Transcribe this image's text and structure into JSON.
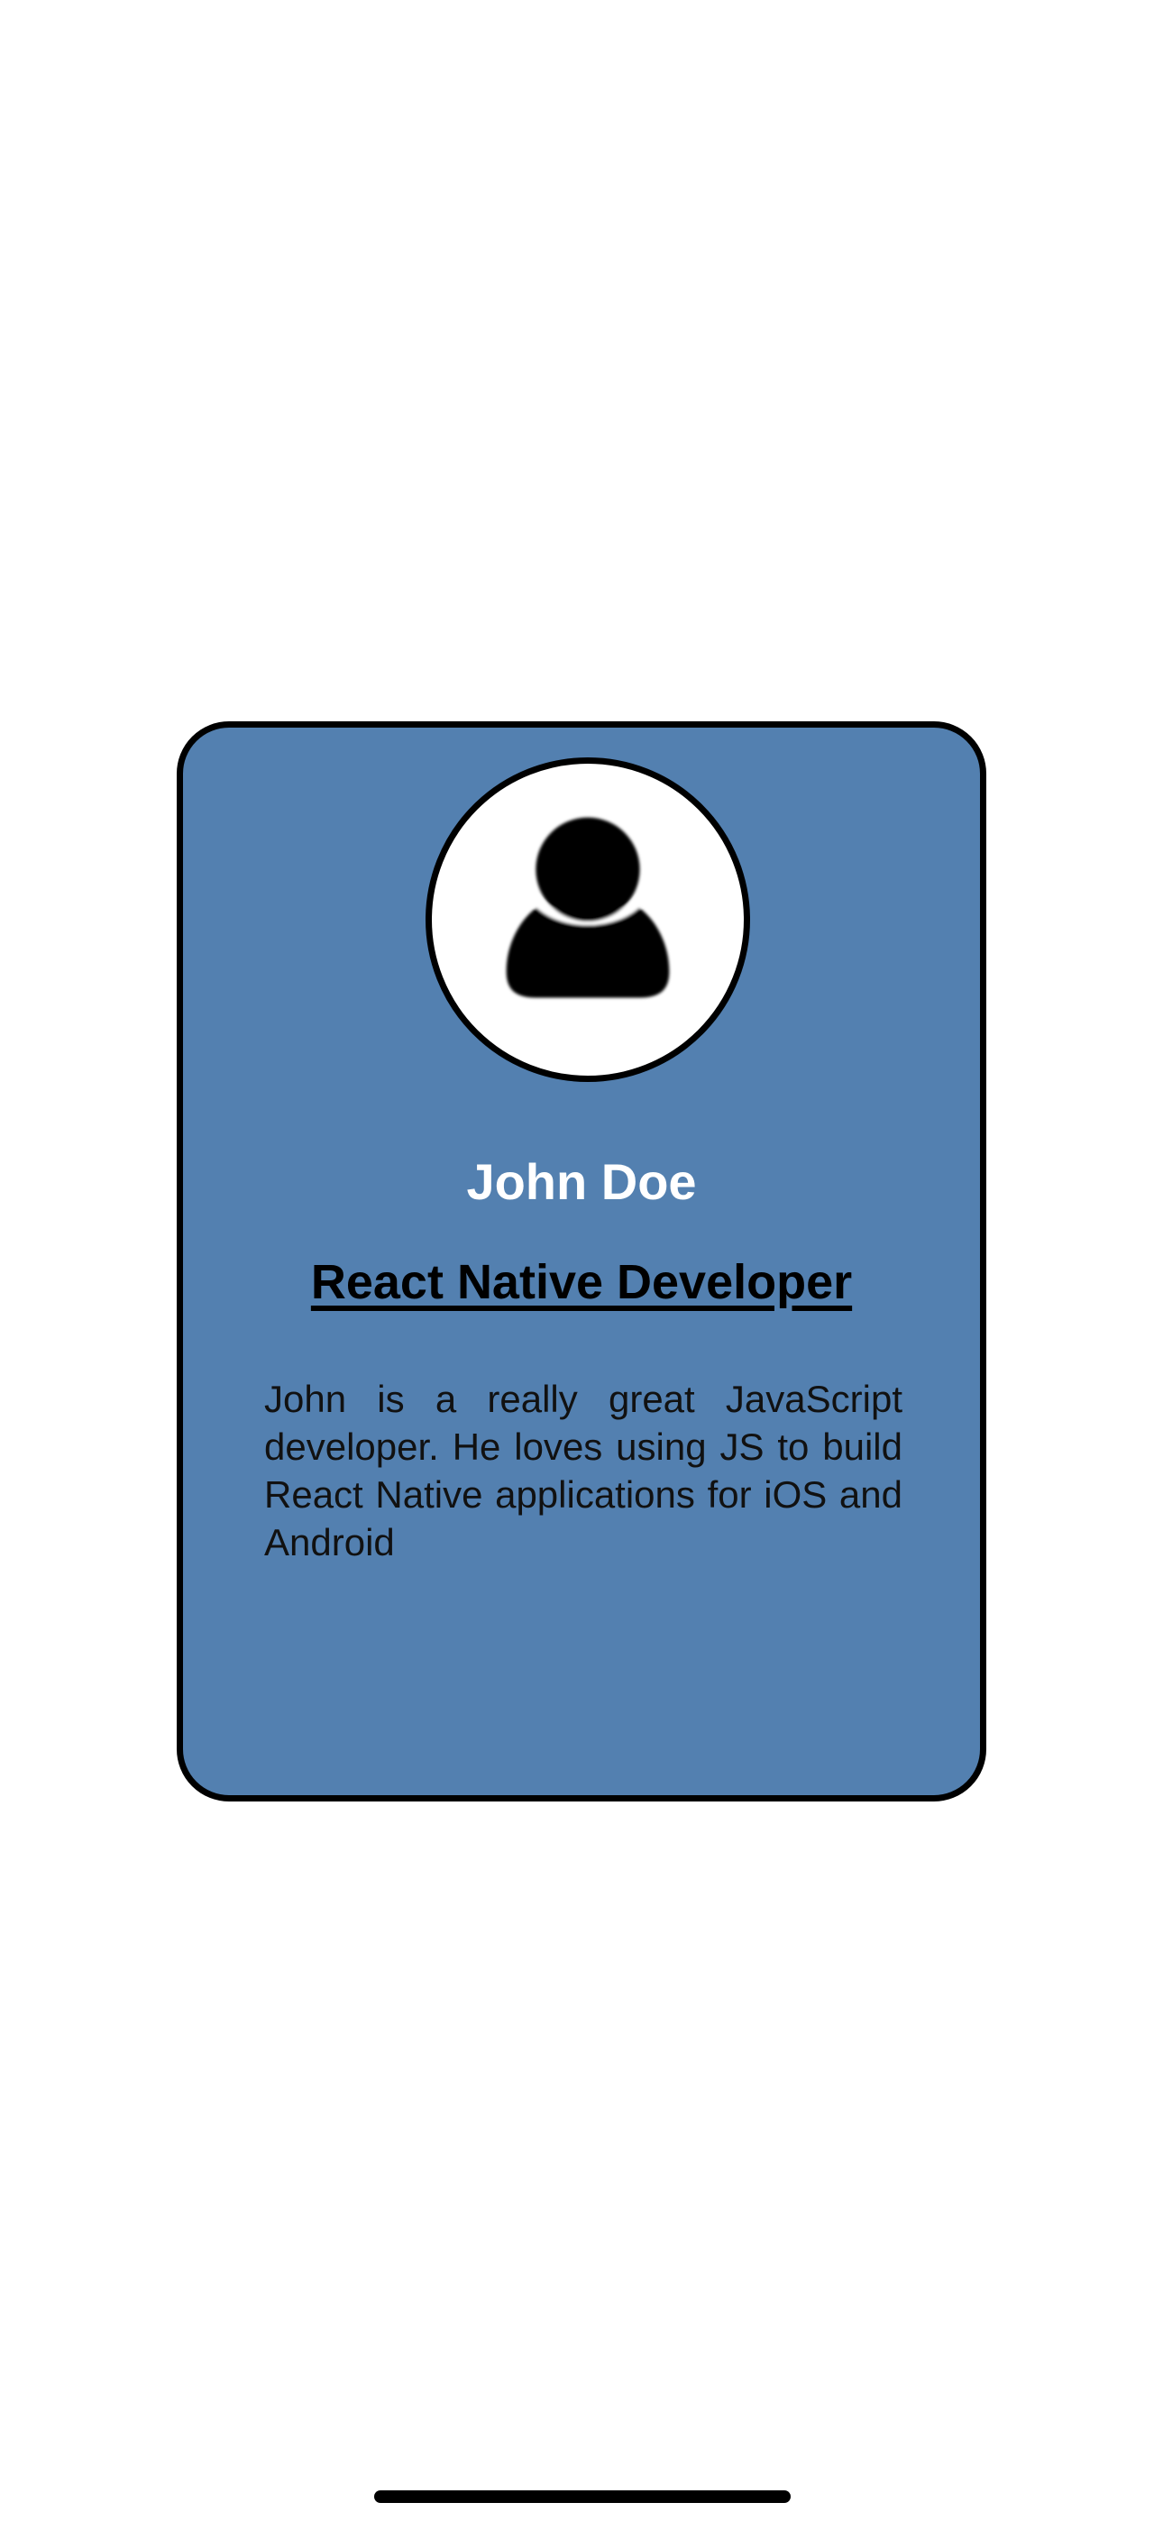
{
  "profile": {
    "avatar_icon": "user-icon",
    "name": "John Doe",
    "title": "React Native Developer",
    "bio": "John is a really great JavaScript developer. He loves using JS to build React Native applications for iOS and Android"
  },
  "colors": {
    "card_background": "#5380b0",
    "border": "#000000",
    "name_text": "#ffffff",
    "title_text": "#000000",
    "page_background": "#ffffff"
  }
}
